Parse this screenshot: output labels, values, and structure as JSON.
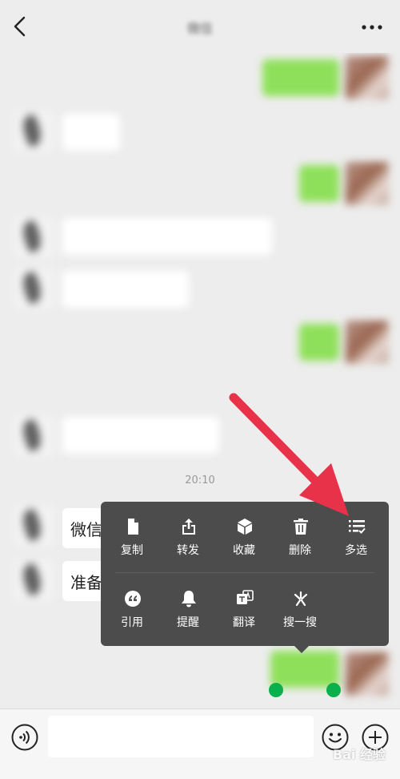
{
  "header": {
    "title": "微信",
    "back_icon": "chevron-left-icon",
    "more_icon": "more-dots-icon"
  },
  "chat": {
    "timestamps": [
      "",
      "20:10"
    ],
    "clear_bubbles": [
      "微信",
      "准备"
    ]
  },
  "context_menu": {
    "row1": [
      {
        "label": "复制",
        "icon": "copy-icon"
      },
      {
        "label": "转发",
        "icon": "forward-icon"
      },
      {
        "label": "收藏",
        "icon": "favorite-icon"
      },
      {
        "label": "删除",
        "icon": "delete-icon"
      },
      {
        "label": "多选",
        "icon": "multi-select-icon"
      }
    ],
    "row2": [
      {
        "label": "引用",
        "icon": "quote-icon"
      },
      {
        "label": "提醒",
        "icon": "remind-icon"
      },
      {
        "label": "翻译",
        "icon": "translate-icon"
      },
      {
        "label": "搜一搜",
        "icon": "search-one-search-icon"
      }
    ]
  },
  "input_bar": {
    "voice_icon": "voice-icon",
    "message_value": "",
    "emoji_icon": "emoji-icon",
    "plus_icon": "plus-icon"
  },
  "watermark": {
    "text": "Bai 经验"
  },
  "colors": {
    "background": "#ededed",
    "sent_bubble": "#8ee05a",
    "menu_bg": "#4c4c4c",
    "arrow": "#e8324a",
    "handle": "#0ab04c"
  }
}
